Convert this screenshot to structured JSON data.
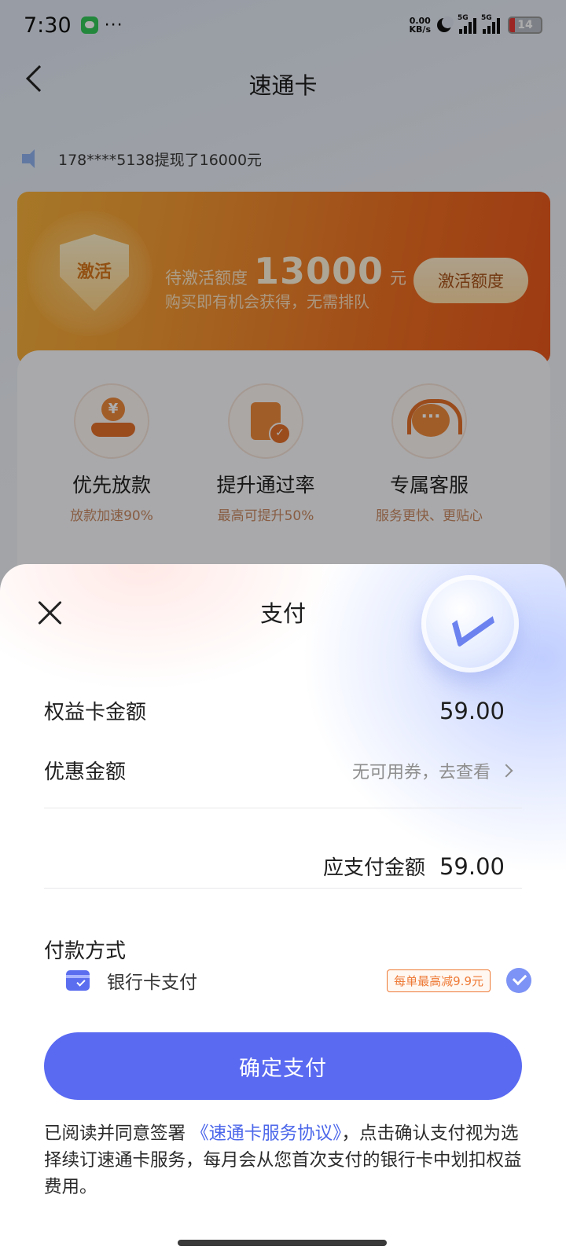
{
  "status_bar": {
    "time": "7:30",
    "dots": "···",
    "net_speed_value": "0.00",
    "net_speed_unit": "KB/s",
    "signal_1": "5G",
    "signal_2": "5G",
    "battery": "14"
  },
  "header": {
    "title": "速通卡"
  },
  "notice": {
    "text": "178****5138提现了16000元"
  },
  "promo": {
    "shield_text": "激活",
    "pending_label": "待激活额度",
    "amount": "13000",
    "unit": "元",
    "subtitle": "购买即有机会获得，无需排队",
    "button": "激活额度",
    "gradient_start": "#f6b13b",
    "gradient_end": "#e8561c"
  },
  "benefits": [
    {
      "title": "优先放款",
      "subtitle": "放款加速90%",
      "icon": "hand-money-icon"
    },
    {
      "title": "提升通过率",
      "subtitle": "最高可提升50%",
      "icon": "document-check-icon"
    },
    {
      "title": "专属客服",
      "subtitle": "服务更快、更贴心",
      "icon": "headset-icon"
    }
  ],
  "payment_sheet": {
    "title": "支付",
    "card_amount_label": "权益卡金额",
    "card_amount_value": "59.00",
    "discount_label": "优惠金额",
    "discount_value": "无可用券，去查看",
    "total_label": "应支付金额",
    "total_value": "59.00",
    "method_heading": "付款方式",
    "method_label": "银行卡支付",
    "method_tag": "每单最高减9.9元",
    "method_selected": true,
    "pay_button": "确定支付",
    "agreement_prefix": "已阅读并同意签署",
    "agreement_link": "《速通卡服务协议》",
    "agreement_suffix": "，点击确认支付视为选择续订速通卡服务，每月会从您首次支付的银行卡中划扣权益费用。",
    "accent_color": "#5a6af1"
  }
}
